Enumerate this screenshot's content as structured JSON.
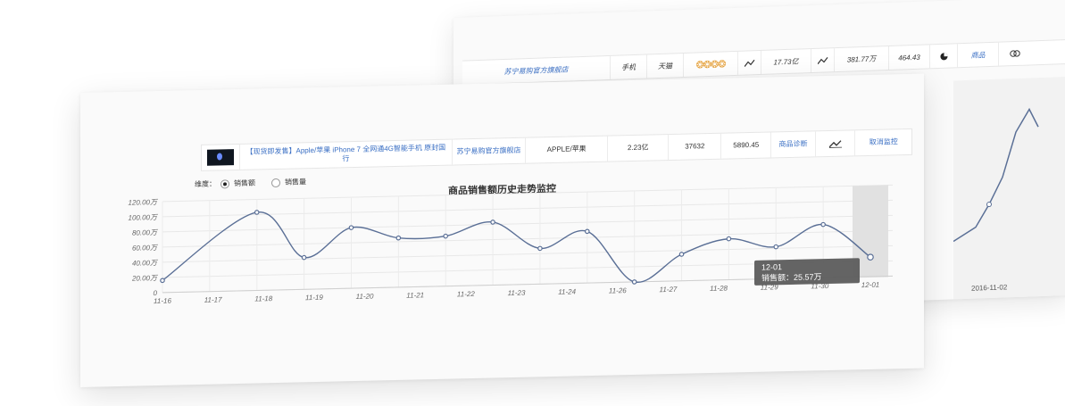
{
  "back_panel": {
    "row": {
      "shop": "苏宁易购官方旗舰店",
      "category": "手机",
      "day_label": "天猫",
      "rating_stars": "❂❂❂❂",
      "value1": "17.73亿",
      "value2": "381.77万",
      "value3": "464.43",
      "action_link": "商品"
    },
    "x_tick": "2016-11-02"
  },
  "front_panel": {
    "row": {
      "product_title": "【现货即发售】Apple/苹果 iPhone 7 全网通4G智能手机 原封国行",
      "shop": "苏宁易购官方旗舰店",
      "brand": "APPLE/苹果",
      "sales_amount": "2.23亿",
      "sales_volume": "37632",
      "avg_price": "5890.45",
      "detail_link": "商品诊断",
      "cancel_link": "取消监控"
    },
    "dimension_label": "维度：",
    "option_amount": "销售额",
    "option_volume": "销售量"
  },
  "chart_data": {
    "type": "line",
    "title": "商品销售额历史走势监控",
    "categories": [
      "11-16",
      "11-17",
      "11-18",
      "11-19",
      "11-20",
      "11-21",
      "11-22",
      "11-23",
      "11-24",
      "11-26",
      "11-27",
      "11-28",
      "11-29",
      "11-30",
      "12-01"
    ],
    "y_ticks": [
      "120.00万",
      "100.00万",
      "80.00万",
      "60.00万",
      "40.00万",
      "20.00万",
      "0"
    ],
    "ylim": [
      0,
      120
    ],
    "unit": "万",
    "series": [
      {
        "values": [
          16,
          null,
          103,
          42,
          80,
          65,
          66,
          83,
          47,
          68,
          0,
          35,
          54,
          42,
          70,
          25.57
        ]
      }
    ],
    "tooltip": {
      "date": "12-01",
      "label": "销售额：25.57万"
    },
    "highlight_category": "12-01",
    "colors": {
      "line": "#5a6f96",
      "highlight": "#e1e1e1",
      "tooltip": "#5c5c5c"
    },
    "grid": true
  }
}
